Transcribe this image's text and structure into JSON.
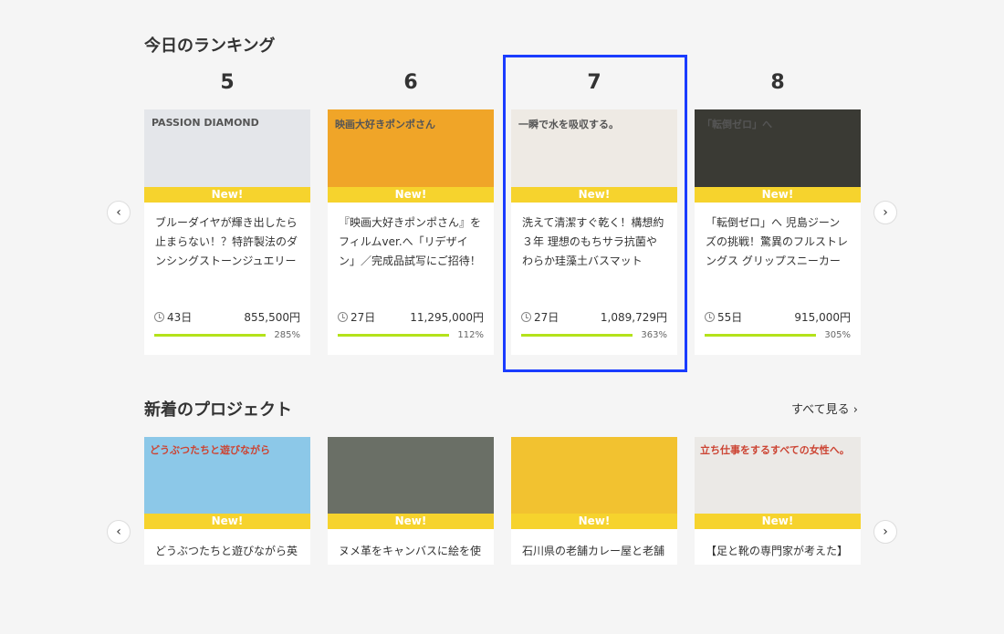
{
  "ranking": {
    "title": "今日のランキング",
    "badge": "New!",
    "cards": [
      {
        "rank": "5",
        "title": "ブルーダイヤが輝き出したら止まらない！？特許製法のダンシングストーンジュエリー",
        "days": "43日",
        "amount": "855,500円",
        "percent": "285%",
        "progress": 285,
        "image_color": "#e4e6ea",
        "image_text": "PASSION DIAMOND"
      },
      {
        "rank": "6",
        "title": "『映画大好きポンポさん』をフィルムver.へ「リデザイン」／完成品試写にご招待！",
        "days": "27日",
        "amount": "11,295,000円",
        "percent": "112%",
        "progress": 112,
        "image_color": "#f0a528",
        "image_text": "映画大好きポンポさん"
      },
      {
        "rank": "7",
        "title": "洗えて清潔すぐ乾く！構想約３年 理想のもちサラ抗菌やわらか珪藻土バスマット",
        "days": "27日",
        "amount": "1,089,729円",
        "percent": "363%",
        "progress": 363,
        "image_color": "#eeeae4",
        "image_text": "一瞬で水を吸収する。"
      },
      {
        "rank": "8",
        "title": "「転倒ゼロ」へ 児島ジーンズの挑戦！驚異のフルストレングス グリップスニーカー",
        "days": "55日",
        "amount": "915,000円",
        "percent": "305%",
        "progress": 305,
        "image_color": "#3a3a34",
        "image_text": "「転倒ゼロ」へ"
      }
    ]
  },
  "new_projects": {
    "title": "新着のプロジェクト",
    "see_all": "すべて見る",
    "badge": "New!",
    "cards": [
      {
        "title": "どうぶつたちと遊びながら英",
        "image_color": "#8cc8e8",
        "image_text": "どうぶつたちと遊びながら"
      },
      {
        "title": "ヌメ革をキャンバスに絵を使",
        "image_color": "#6a6f66",
        "image_text": ""
      },
      {
        "title": "石川県の老舗カレー屋と老舗",
        "image_color": "#f2c230",
        "image_text": ""
      },
      {
        "title": "【足と靴の専門家が考えた】",
        "image_color": "#ebe9e6",
        "image_text": "立ち仕事をするすべての女性へ。"
      }
    ]
  },
  "highlight_color": "#1a3cff"
}
